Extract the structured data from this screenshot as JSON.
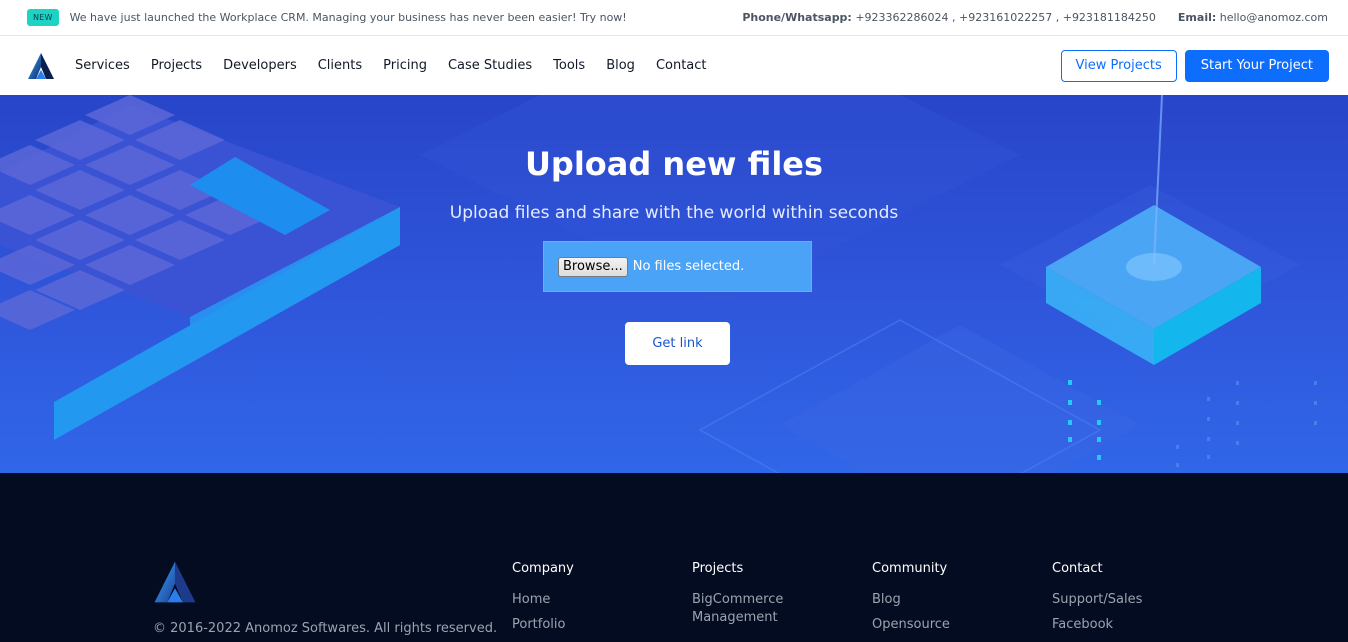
{
  "topbar": {
    "badge": "NEW",
    "announcement": "We have just launched the Workplace CRM. Managing your business has never been easier! Try now!",
    "phone_label": "Phone/Whatsapp:",
    "phone_values": "+923362286024 , +923161022257 , +923181184250",
    "email_label": "Email:",
    "email_value": "hello@anomoz.com"
  },
  "nav": {
    "links": [
      "Services",
      "Projects",
      "Developers",
      "Clients",
      "Pricing",
      "Case Studies",
      "Tools",
      "Blog",
      "Contact"
    ],
    "view_projects": "View Projects",
    "start_project": "Start Your Project"
  },
  "hero": {
    "title": "Upload new files",
    "subtitle": "Upload files and share with the world within seconds",
    "browse_label": "Browse...",
    "file_status": "No files selected.",
    "get_link": "Get link"
  },
  "footer": {
    "copyright": "© 2016-2022 Anomoz Softwares. All rights reserved.",
    "columns": [
      {
        "title": "Company",
        "links": [
          "Home",
          "Portfolio"
        ]
      },
      {
        "title": "Projects",
        "links": [
          "BigCommerce Management"
        ]
      },
      {
        "title": "Community",
        "links": [
          "Blog",
          "Opensource"
        ]
      },
      {
        "title": "Contact",
        "links": [
          "Support/Sales",
          "Facebook"
        ]
      }
    ]
  },
  "colors": {
    "accent": "#0d6efd",
    "hero_bg": "#2f56db",
    "footer_bg": "#040c22",
    "badge": "#1dd3c3"
  }
}
